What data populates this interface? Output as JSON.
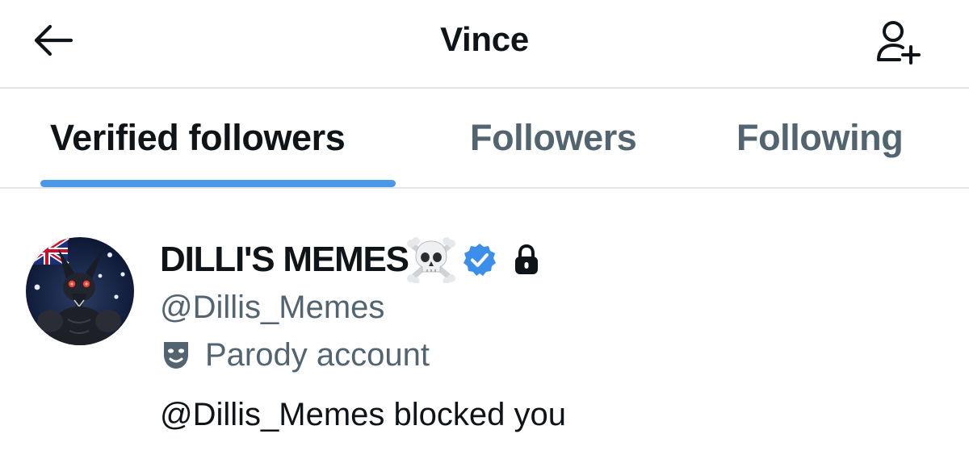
{
  "header": {
    "title": "Vince",
    "back_icon": "arrow-left-icon",
    "follow_icon": "person-add-icon"
  },
  "tabs": [
    {
      "label": "Verified followers",
      "active": true
    },
    {
      "label": "Followers",
      "active": false
    },
    {
      "label": "Following",
      "active": false
    }
  ],
  "user": {
    "display_name": "DILLI'S MEMES",
    "name_emoji": "skull-crossbones-icon",
    "verified_badge": "verified-badge-icon",
    "protected_icon": "lock-icon",
    "handle": "@Dillis_Memes",
    "parody_label": "Parody account",
    "parody_icon": "theater-mask-icon",
    "status_text": "@Dillis_Memes blocked you"
  },
  "colors": {
    "accent": "#4a99e9",
    "primary_text": "#0f1419",
    "secondary_text": "#536471",
    "divider": "#e4e7ea"
  }
}
